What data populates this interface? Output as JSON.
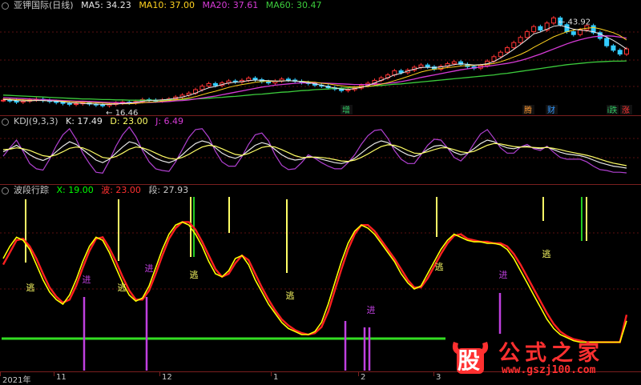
{
  "title": "亚钾国际(日线)",
  "colors": {
    "bg": "#000000",
    "grid": "#5a1010",
    "separator": "#7a1f1f",
    "up": "#ff3333",
    "down": "#33ccff",
    "ma5": "#e8e8e8",
    "ma10": "#ffd21f",
    "ma20": "#d63bd6",
    "ma60": "#3ccc3c",
    "k": "#e8e8e8",
    "d": "#ffff66",
    "j": "#b040d0",
    "x": "#ffff00",
    "bo": "#ff2020",
    "duan": "#00d000",
    "flag_escape": "#ffff66",
    "flag_enter": "#c040e0",
    "flag_green": "#22cc22"
  },
  "main_legend": [
    {
      "text": "MA5: 34.23",
      "color": "#e8e8e8"
    },
    {
      "text": "MA10: 37.00",
      "color": "#ffd21f"
    },
    {
      "text": "MA20: 37.61",
      "color": "#d63bd6"
    },
    {
      "text": "MA60: 30.47",
      "color": "#3ccc3c"
    }
  ],
  "kdj_legend": [
    {
      "text": "KDJ(9,3,3)",
      "color": "#c8c8c8"
    },
    {
      "text": "K: 17.49",
      "color": "#e8e8e8"
    },
    {
      "text": "D: 23.00",
      "color": "#ffff66"
    },
    {
      "text": "J: 6.49",
      "color": "#d63bd6"
    }
  ],
  "wave_legend": [
    {
      "text": "波段行踪",
      "color": "#c8c8c8"
    },
    {
      "text": "X: 19.00",
      "color": "#00ff00"
    },
    {
      "text": "波: 23.00",
      "color": "#ff3030"
    },
    {
      "text": "段: 27.93",
      "color": "#c8c8c8"
    }
  ],
  "annotations": {
    "high": "43.92",
    "low": "16.46"
  },
  "event_markers": [
    {
      "text": "增",
      "color": "#33cc66"
    },
    {
      "text": "腾",
      "color": "#ff9933"
    },
    {
      "text": "财",
      "color": "#3399ff"
    },
    {
      "text": "i跌",
      "color": "#33cc66"
    },
    {
      "text": "涨",
      "color": "#ff3333"
    }
  ],
  "x_labels": [
    "2021年",
    "11",
    "12",
    "1",
    "2",
    "3"
  ],
  "signal_labels": {
    "escape": "逃",
    "enter": "进"
  },
  "logo": {
    "main": "公式之家",
    "badge": "股",
    "url": "www.gszj100.com"
  },
  "chart_data": [
    {
      "type": "candlestick",
      "title": "亚钾国际(日线)",
      "series_close": [
        18.2,
        18.0,
        17.6,
        17.9,
        18.3,
        18.5,
        18.1,
        17.8,
        17.5,
        17.2,
        16.9,
        17.1,
        17.4,
        17.0,
        16.7,
        16.5,
        16.9,
        17.3,
        17.6,
        17.4,
        17.8,
        18.4,
        18.2,
        18.0,
        18.3,
        18.6,
        19.2,
        19.8,
        20.4,
        21.5,
        22.6,
        23.4,
        22.8,
        23.6,
        24.2,
        23.9,
        24.4,
        25.1,
        24.6,
        24.0,
        23.6,
        24.2,
        24.8,
        24.5,
        24.1,
        23.7,
        23.4,
        22.9,
        22.6,
        22.1,
        21.7,
        21.2,
        21.5,
        22.0,
        22.8,
        23.5,
        24.4,
        25.2,
        26.1,
        27.4,
        26.8,
        27.6,
        28.5,
        29.2,
        28.6,
        27.9,
        28.8,
        29.6,
        30.2,
        29.4,
        28.7,
        28.2,
        29.0,
        30.4,
        31.8,
        33.2,
        34.6,
        36.2,
        37.8,
        39.6,
        41.2,
        40.1,
        42.3,
        43.9,
        41.8,
        39.6,
        38.7,
        40.2,
        41.5,
        39.3,
        37.5,
        35.2,
        33.8,
        32.6,
        34.23
      ],
      "series_ma5": [
        18.4,
        18.3,
        18.1,
        18.0,
        18.0,
        18.1,
        18.1,
        18.0,
        17.9,
        17.7,
        17.4,
        17.3,
        17.2,
        17.1,
        17.0,
        16.9,
        16.9,
        17.0,
        17.2,
        17.3,
        17.6,
        17.9,
        18.1,
        18.2,
        18.3,
        18.5,
        18.8,
        19.2,
        19.7,
        20.4,
        21.3,
        22.1,
        22.5,
        23.1,
        23.6,
        23.8,
        24.0,
        24.3,
        24.5,
        24.4,
        24.3,
        24.2,
        24.2,
        24.3,
        24.2,
        24.0,
        23.7,
        23.3,
        22.9,
        22.4,
        22.0,
        21.7,
        21.6,
        21.8,
        22.2,
        22.8,
        23.6,
        24.4,
        25.2,
        26.1,
        26.6,
        27.3,
        27.9,
        28.4,
        28.5,
        28.4,
        28.6,
        28.9,
        29.3,
        29.6,
        29.4,
        29.2,
        29.3,
        29.6,
        30.3,
        31.4,
        32.7,
        34.1,
        35.6,
        37.2,
        38.9,
        39.5,
        40.4,
        41.3,
        41.6,
        41.0,
        40.4,
        40.1,
        39.9,
        39.6,
        38.9,
        37.9,
        36.9,
        35.6,
        34.2
      ],
      "series_ma10": [
        18.6,
        18.5,
        18.4,
        18.3,
        18.2,
        18.2,
        18.1,
        18.0,
        18.0,
        17.9,
        17.8,
        17.7,
        17.6,
        17.5,
        17.4,
        17.3,
        17.2,
        17.1,
        17.1,
        17.1,
        17.2,
        17.4,
        17.6,
        17.7,
        17.9,
        18.1,
        18.3,
        18.6,
        18.9,
        19.3,
        19.9,
        20.5,
        21.0,
        21.6,
        22.2,
        22.7,
        23.1,
        23.4,
        23.8,
        24.0,
        24.1,
        24.1,
        24.2,
        24.3,
        24.2,
        24.1,
        24.0,
        23.8,
        23.5,
        23.3,
        23.0,
        22.7,
        22.4,
        22.3,
        22.4,
        22.5,
        22.8,
        23.2,
        23.7,
        24.3,
        24.9,
        25.6,
        26.3,
        27.0,
        27.5,
        27.9,
        28.1,
        28.4,
        28.6,
        28.9,
        29.0,
        29.1,
        29.2,
        29.4,
        29.7,
        30.2,
        30.9,
        31.7,
        32.5,
        33.5,
        34.7,
        35.8,
        36.9,
        38.0,
        38.8,
        39.6,
        40.1,
        40.4,
        40.7,
        40.9,
        40.5,
        39.9,
        39.3,
        38.4,
        37.0
      ],
      "series_ma20": [
        19.0,
        18.9,
        18.8,
        18.7,
        18.6,
        18.5,
        18.4,
        18.3,
        18.2,
        18.1,
        18.0,
        17.9,
        17.9,
        17.8,
        17.7,
        17.6,
        17.5,
        17.5,
        17.4,
        17.4,
        17.4,
        17.5,
        17.5,
        17.6,
        17.7,
        17.8,
        18.0,
        18.1,
        18.3,
        18.6,
        18.9,
        19.2,
        19.5,
        19.9,
        20.3,
        20.7,
        21.1,
        21.5,
        21.9,
        22.3,
        22.6,
        22.9,
        23.1,
        23.3,
        23.5,
        23.6,
        23.6,
        23.6,
        23.6,
        23.5,
        23.4,
        23.3,
        23.2,
        23.1,
        23.1,
        23.1,
        23.2,
        23.3,
        23.5,
        23.7,
        24.0,
        24.4,
        24.8,
        25.3,
        25.7,
        26.1,
        26.5,
        26.9,
        27.3,
        27.7,
        28.0,
        28.3,
        28.6,
        28.8,
        29.1,
        29.4,
        29.7,
        30.1,
        30.6,
        31.2,
        31.9,
        32.6,
        33.4,
        34.2,
        35.0,
        35.8,
        36.5,
        37.1,
        37.6,
        38.0,
        38.2,
        38.3,
        38.2,
        37.9,
        37.61
      ],
      "series_ma60": [
        19.8,
        19.7,
        19.6,
        19.5,
        19.4,
        19.3,
        19.2,
        19.1,
        19.0,
        18.9,
        18.8,
        18.7,
        18.6,
        18.6,
        18.5,
        18.4,
        18.4,
        18.3,
        18.3,
        18.2,
        18.2,
        18.2,
        18.2,
        18.2,
        18.2,
        18.3,
        18.3,
        18.4,
        18.5,
        18.6,
        18.7,
        18.8,
        19.0,
        19.1,
        19.3,
        19.4,
        19.6,
        19.8,
        20.0,
        20.1,
        20.3,
        20.5,
        20.7,
        20.8,
        21.0,
        21.2,
        21.3,
        21.5,
        21.6,
        21.7,
        21.9,
        22.0,
        22.1,
        22.3,
        22.4,
        22.5,
        22.7,
        22.8,
        23.0,
        23.2,
        23.3,
        23.5,
        23.7,
        23.9,
        24.1,
        24.3,
        24.5,
        24.7,
        24.9,
        25.1,
        25.3,
        25.5,
        25.7,
        25.9,
        26.1,
        26.4,
        26.6,
        26.9,
        27.2,
        27.5,
        27.8,
        28.1,
        28.4,
        28.7,
        29.0,
        29.3,
        29.5,
        29.7,
        29.9,
        30.1,
        30.2,
        30.3,
        30.4,
        30.4,
        30.47
      ],
      "annotations": {
        "high": 43.92,
        "low": 16.46
      }
    },
    {
      "type": "line",
      "title": "KDJ(9,3,3)",
      "series": [
        {
          "name": "K",
          "values": [
            55,
            62,
            70,
            60,
            48,
            40,
            35,
            42,
            55,
            68,
            78,
            72,
            60,
            48,
            36,
            30,
            38,
            52,
            66,
            78,
            74,
            62,
            50,
            40,
            34,
            30,
            36,
            48,
            62,
            74,
            80,
            76,
            64,
            52,
            44,
            40,
            46,
            58,
            70,
            76,
            72,
            60,
            48,
            40,
            36,
            38,
            44,
            42,
            38,
            34,
            30,
            28,
            32,
            40,
            52,
            64,
            74,
            80,
            76,
            66,
            56,
            48,
            44,
            50,
            60,
            68,
            70,
            64,
            54,
            48,
            52,
            62,
            74,
            82,
            78,
            70,
            64,
            62,
            66,
            68,
            64,
            62,
            66,
            60,
            54,
            50,
            48,
            46,
            42,
            36,
            30,
            26,
            22,
            20,
            17.49
          ]
        },
        {
          "name": "D",
          "values": [
            60,
            61,
            64,
            62,
            58,
            52,
            46,
            44,
            48,
            55,
            63,
            66,
            64,
            58,
            50,
            42,
            40,
            44,
            52,
            61,
            66,
            64,
            59,
            52,
            45,
            40,
            38,
            42,
            49,
            58,
            66,
            70,
            68,
            62,
            55,
            49,
            47,
            51,
            58,
            65,
            68,
            66,
            60,
            53,
            46,
            42,
            42,
            43,
            42,
            40,
            37,
            34,
            33,
            36,
            42,
            50,
            59,
            67,
            71,
            70,
            65,
            58,
            52,
            51,
            55,
            60,
            64,
            64,
            60,
            55,
            53,
            56,
            63,
            70,
            74,
            73,
            70,
            67,
            66,
            66,
            65,
            64,
            65,
            63,
            60,
            56,
            53,
            50,
            47,
            43,
            38,
            33,
            29,
            26,
            23.0
          ]
        },
        {
          "name": "J",
          "values": [
            45,
            64,
            82,
            56,
            28,
            16,
            13,
            38,
            69,
            94,
            108,
            84,
            52,
            28,
            8,
            6,
            34,
            68,
            94,
            112,
            90,
            58,
            32,
            16,
            12,
            10,
            32,
            60,
            88,
            106,
            108,
            88,
            56,
            32,
            22,
            22,
            44,
            72,
            94,
            98,
            80,
            48,
            24,
            14,
            16,
            30,
            48,
            40,
            30,
            22,
            16,
            16,
            30,
            48,
            72,
            92,
            104,
            106,
            86,
            58,
            38,
            28,
            28,
            48,
            70,
            84,
            82,
            64,
            42,
            34,
            50,
            74,
            96,
            106,
            86,
            64,
            52,
            52,
            66,
            72,
            62,
            58,
            68,
            54,
            42,
            38,
            38,
            38,
            32,
            22,
            14,
            12,
            8,
            8,
            6.49
          ]
        }
      ]
    },
    {
      "type": "line",
      "title": "波段行踪",
      "series": [
        {
          "name": "X",
          "values": [
            60,
            68,
            74,
            72,
            66,
            56,
            46,
            38,
            33,
            30,
            36,
            46,
            58,
            68,
            74,
            72,
            64,
            54,
            44,
            36,
            32,
            34,
            42,
            54,
            66,
            76,
            82,
            84,
            82,
            76,
            68,
            58,
            50,
            48,
            52,
            60,
            62,
            56,
            46,
            38,
            30,
            24,
            18,
            14,
            12,
            10,
            10,
            12,
            18,
            30,
            44,
            58,
            70,
            78,
            82,
            80,
            76,
            70,
            64,
            58,
            50,
            44,
            40,
            42,
            50,
            58,
            66,
            72,
            76,
            74,
            72,
            71,
            71,
            70,
            70,
            69,
            66,
            60,
            52,
            44,
            36,
            28,
            20,
            14,
            10,
            8,
            6,
            5,
            5,
            5,
            5,
            5,
            5,
            5,
            19.0
          ]
        },
        {
          "name": "波",
          "values": [
            56,
            64,
            72,
            73,
            68,
            60,
            50,
            41,
            35,
            31,
            33,
            42,
            54,
            65,
            73,
            74,
            67,
            58,
            48,
            39,
            33,
            33,
            39,
            50,
            62,
            73,
            80,
            84,
            84,
            79,
            71,
            62,
            53,
            48,
            50,
            57,
            62,
            59,
            50,
            41,
            33,
            26,
            20,
            16,
            13,
            11,
            10,
            11,
            15,
            25,
            39,
            53,
            66,
            76,
            82,
            82,
            78,
            72,
            66,
            60,
            53,
            46,
            41,
            41,
            47,
            55,
            63,
            70,
            75,
            76,
            73,
            72,
            71,
            71,
            70,
            70,
            68,
            63,
            56,
            48,
            40,
            32,
            24,
            17,
            12,
            9,
            7,
            6,
            5,
            5,
            5,
            5,
            5,
            5,
            23.0
          ]
        }
      ],
      "duan_level": 27.93,
      "signals": [
        "逃",
        "进",
        "逃",
        "进",
        "逃",
        "逃",
        "进",
        "逃",
        "进",
        "逃"
      ]
    }
  ]
}
